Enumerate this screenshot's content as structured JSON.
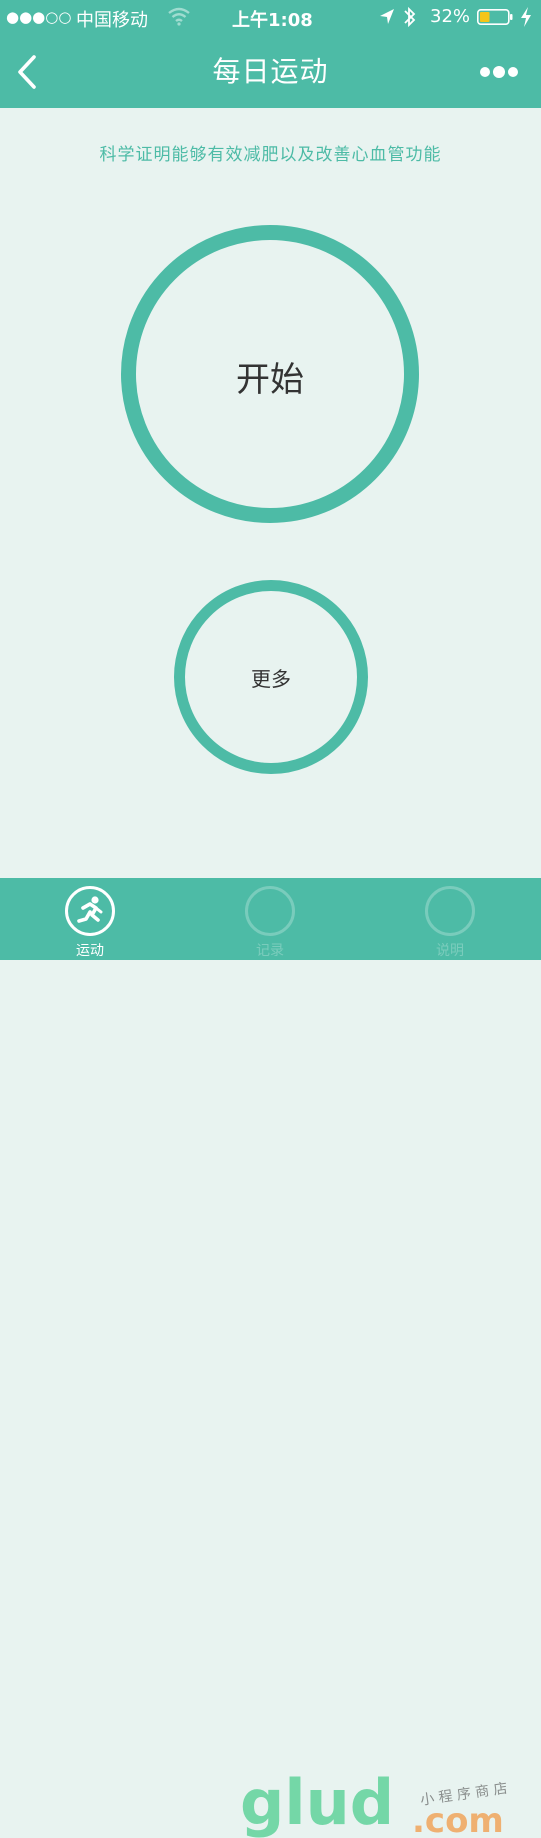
{
  "status_bar": {
    "signal": "●●●○○",
    "carrier": "中国移动",
    "time": "上午1:08",
    "battery_percent": "32%"
  },
  "nav": {
    "title": "每日运动"
  },
  "main": {
    "subtitle": "科学证明能够有效减肥以及改善心血管功能",
    "start_label": "开始",
    "more_label": "更多"
  },
  "tabs": [
    {
      "label": "运动",
      "icon": "runner-icon",
      "active": true
    },
    {
      "label": "记录",
      "icon": "record-icon",
      "active": false
    },
    {
      "label": "说明",
      "icon": "info-icon",
      "active": false
    }
  ],
  "watermark": {
    "brand": "glud",
    "suffix": ".com",
    "tagline": "小程序商店"
  },
  "colors": {
    "accent": "#4dbba6",
    "background": "#e8f3f0",
    "text": "#333333",
    "battery_fill": "#f5c518"
  }
}
